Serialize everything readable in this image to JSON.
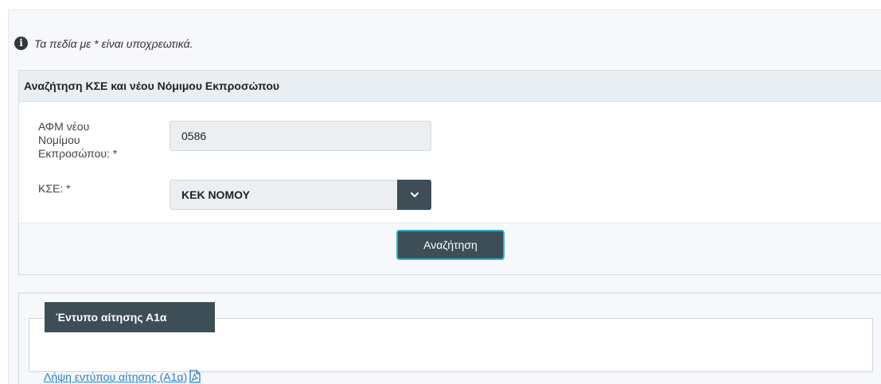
{
  "note": {
    "text": "Τα πεδία με * είναι υποχρεωτικά."
  },
  "search_panel": {
    "title": "Αναζήτηση ΚΣΕ και νέου Νόμιμου Εκπροσώπου",
    "afm_label_1": "ΑΦΜ νέου",
    "afm_label_2": "Νομίμου",
    "afm_label_3": "Εκπροσώπου:  *",
    "afm_value": "0586",
    "kse_label": "ΚΣΕ:  *",
    "kse_selected": "ΚΕΚ ΝΟΜΟΥ",
    "search_button": "Αναζήτηση"
  },
  "form_panel": {
    "legend": "Έντυπο αίτησης Α1α",
    "download_link": "Λήψη εντύπου αίτησης (Α1α)"
  },
  "icons": {
    "info": "info-circle-icon",
    "dropdown": "chevron-down-icon",
    "pdf": "pdf-file-icon"
  },
  "colors": {
    "button_bg": "#3d4e57",
    "focus_border": "#29b6d1",
    "link": "#2a7fc4",
    "panel_header_bg": "#e9eef3"
  }
}
